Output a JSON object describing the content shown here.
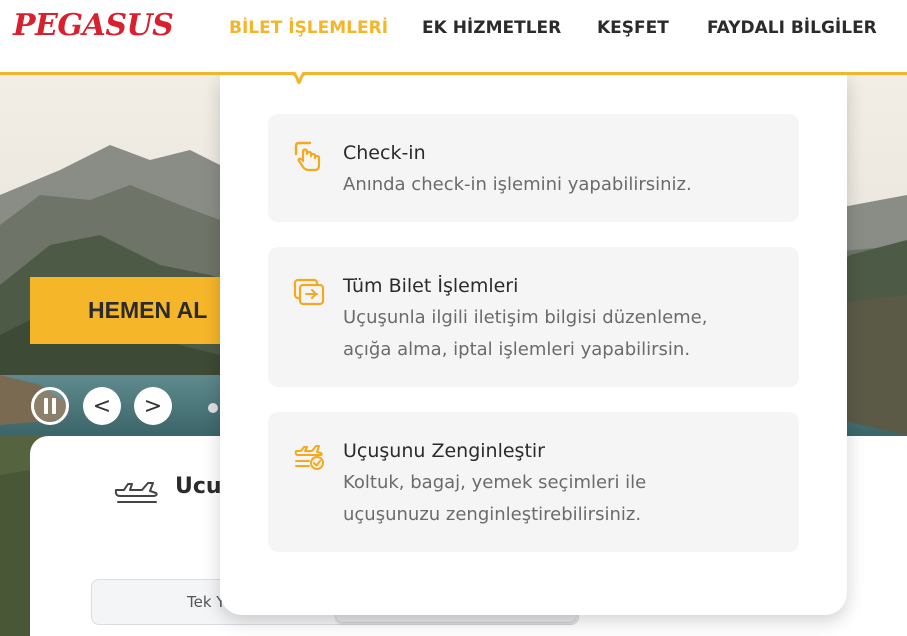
{
  "brand": {
    "logo_text": "PEGASUS",
    "accent_color": "#f4b52a",
    "logo_color": "#d8202f"
  },
  "nav": {
    "items": [
      {
        "label": "BİLET İŞLEMLERİ",
        "active": true
      },
      {
        "label": "EK HİZMETLER",
        "active": false
      },
      {
        "label": "KEŞFET",
        "active": false
      },
      {
        "label": "FAYDALI BİLGİLER",
        "active": false
      }
    ]
  },
  "dropdown": {
    "items": [
      {
        "title": "Check-in",
        "icon": "tap-hand-icon",
        "description_lines": [
          "Anında check-in işlemini yapabilirsiniz."
        ]
      },
      {
        "title": "Tüm Bilet İşlemleri",
        "icon": "tickets-icon",
        "description_lines": [
          "Uçuşunla ilgili iletişim bilgisi düzenleme,",
          "açığa alma, iptal işlemleri yapabilirsin."
        ]
      },
      {
        "title": "Uçuşunu Zenginleştir",
        "icon": "plane-check-icon",
        "description_lines": [
          "Koltuk, bagaj, yemek seçimleri ile",
          "uçuşunuzu zenginleştirebilirsiniz."
        ]
      }
    ]
  },
  "hero": {
    "cta_label": "HEMEN AL",
    "controls": {
      "pause_icon": "pause-icon",
      "prev_label": "<",
      "next_label": ">"
    }
  },
  "booking": {
    "title_visible": "Ucuz",
    "trip_type_visible": "Tek Y"
  }
}
